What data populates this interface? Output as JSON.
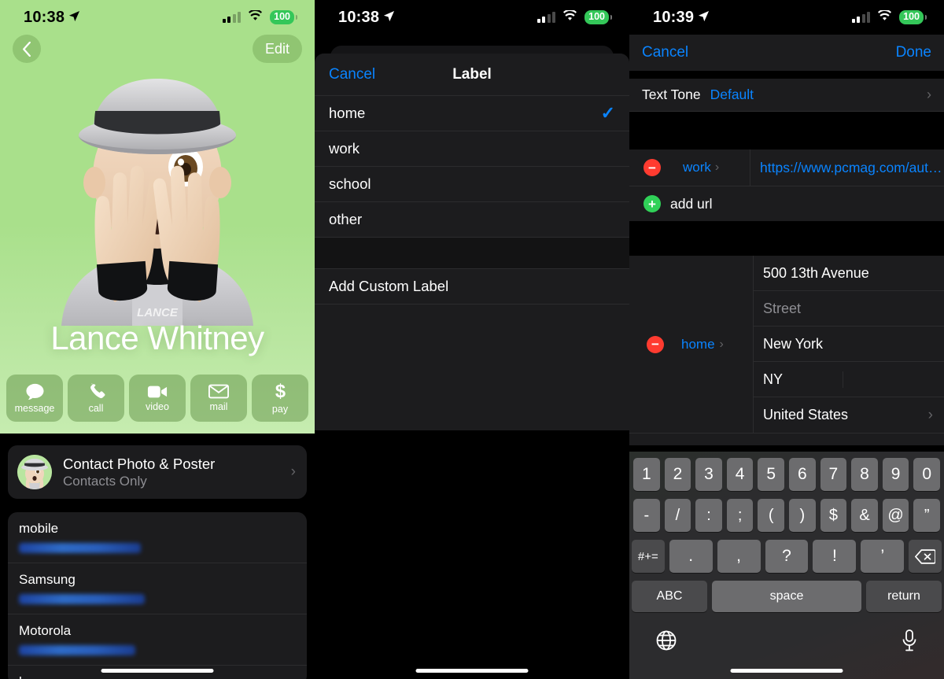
{
  "panel_left": {
    "status": {
      "time": "10:38",
      "battery": "100",
      "location_icon": "location-arrow-icon",
      "signal_icon": "cellular-bars-icon",
      "wifi_icon": "wifi-icon"
    },
    "back_icon": "chevron-left-icon",
    "edit_label": "Edit",
    "poster": {
      "watermark": "LANCE",
      "name": "Lance Whitney",
      "avatar_icon": "memoji-avatar"
    },
    "actions": [
      {
        "label": "message",
        "icon": "message-bubble-icon"
      },
      {
        "label": "call",
        "icon": "phone-icon"
      },
      {
        "label": "video",
        "icon": "video-camera-icon"
      },
      {
        "label": "mail",
        "icon": "envelope-icon"
      },
      {
        "label": "pay",
        "icon": "dollar-sign-icon"
      }
    ],
    "photo_poster": {
      "title": "Contact Photo & Poster",
      "subtitle": "Contacts Only",
      "chevron": "›"
    },
    "fields": [
      {
        "label": "mobile",
        "value": ""
      },
      {
        "label": "Samsung",
        "value": ""
      },
      {
        "label": "Motorola",
        "value": ""
      }
    ],
    "cut_label": "home"
  },
  "panel_mid": {
    "status": {
      "time": "10:38",
      "battery": "100"
    },
    "nav": {
      "cancel": "Cancel",
      "title": "Label"
    },
    "options": [
      {
        "label": "home",
        "selected": true
      },
      {
        "label": "work",
        "selected": false
      },
      {
        "label": "school",
        "selected": false
      },
      {
        "label": "other",
        "selected": false
      }
    ],
    "check_glyph": "✓",
    "add_custom": "Add Custom Label"
  },
  "panel_right": {
    "status": {
      "time": "10:39",
      "battery": "100"
    },
    "nav": {
      "cancel": "Cancel",
      "done": "Done"
    },
    "text_tone": {
      "key": "Text Tone",
      "value": "Default",
      "chevron": "›"
    },
    "url_row": {
      "delete_glyph": "−",
      "label": "work",
      "label_chevron": "›",
      "value": "https://www.pcmag.com/aut…"
    },
    "add_url": {
      "add_glyph": "+",
      "label": "add url"
    },
    "address": {
      "delete_glyph": "−",
      "label": "home",
      "label_chevron": "›",
      "street1": "500 13th Avenue",
      "street2_placeholder": "Street",
      "city": "New York",
      "state": "NY",
      "zip": "",
      "country": "United States",
      "country_chevron": "›"
    },
    "keyboard": {
      "row1": [
        "1",
        "2",
        "3",
        "4",
        "5",
        "6",
        "7",
        "8",
        "9",
        "0"
      ],
      "row2": [
        "-",
        "/",
        ":",
        ";",
        "(",
        ")",
        "$",
        "&",
        "@",
        "”"
      ],
      "row3_left": "#+=",
      "row3": [
        ".",
        ",",
        "?",
        "!",
        "’"
      ],
      "row3_backspace_icon": "backspace-icon",
      "abc": "ABC",
      "space": "space",
      "return": "return",
      "globe_icon": "globe-icon",
      "mic_icon": "microphone-icon"
    }
  },
  "colors": {
    "accent_blue": "#0a84ff",
    "green": "#34c759",
    "red": "#ff3b30",
    "poster_green": "#a9e08b"
  }
}
